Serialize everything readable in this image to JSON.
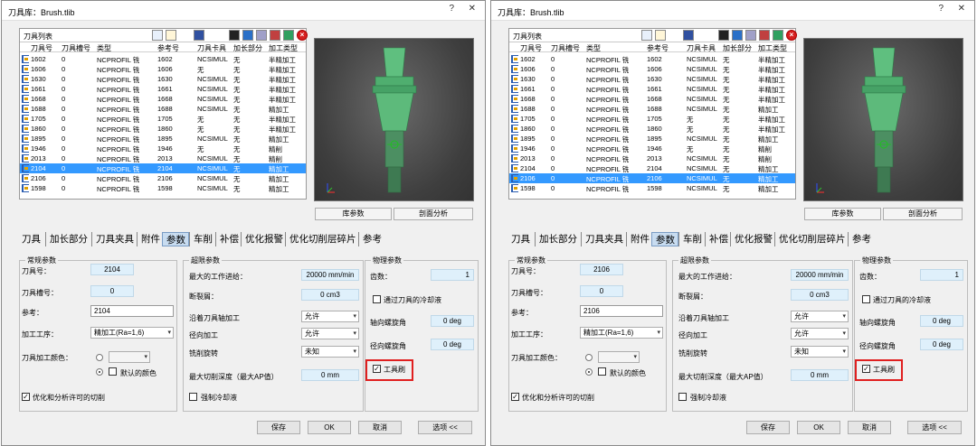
{
  "windows": [
    {
      "title": "刀具库：Brush.tlib",
      "help_glyph": "?",
      "close_glyph": "✕",
      "list_title": "刀具列表",
      "columns": [
        "刀具号",
        "刀具槽号",
        "类型",
        "参考号",
        "刀具卡具",
        "加长部分",
        "加工类型"
      ],
      "rows": [
        [
          "1602",
          "0",
          "NCPROFIL 铣",
          "1602",
          "NCSIMUL",
          "无",
          "半精加工"
        ],
        [
          "1606",
          "0",
          "NCPROFIL 铣",
          "1606",
          "无",
          "无",
          "半精加工"
        ],
        [
          "1630",
          "0",
          "NCPROFIL 铣",
          "1630",
          "NCSIMUL",
          "无",
          "半精加工"
        ],
        [
          "1661",
          "0",
          "NCPROFIL 铣",
          "1661",
          "NCSIMUL",
          "无",
          "半精加工"
        ],
        [
          "1668",
          "0",
          "NCPROFIL 铣",
          "1668",
          "NCSIMUL",
          "无",
          "半精加工"
        ],
        [
          "1688",
          "0",
          "NCPROFIL 铣",
          "1688",
          "NCSIMUL",
          "无",
          "精加工"
        ],
        [
          "1705",
          "0",
          "NCPROFIL 铣",
          "1705",
          "无",
          "无",
          "半精加工"
        ],
        [
          "1860",
          "0",
          "NCPROFIL 铣",
          "1860",
          "无",
          "无",
          "半精加工"
        ],
        [
          "1895",
          "0",
          "NCPROFIL 铣",
          "1895",
          "NCSIMUL",
          "无",
          "精加工"
        ],
        [
          "1946",
          "0",
          "NCPROFIL 铣",
          "1946",
          "无",
          "无",
          "精削"
        ],
        [
          "2013",
          "0",
          "NCPROFIL 铣",
          "2013",
          "NCSIMUL",
          "无",
          "精削"
        ],
        [
          "2104",
          "0",
          "NCPROFIL 铣",
          "2104",
          "NCSIMUL",
          "无",
          "精加工"
        ],
        [
          "2106",
          "0",
          "NCPROFIL 铣",
          "2106",
          "NCSIMUL",
          "无",
          "精加工"
        ],
        [
          "1598",
          "0",
          "NCPROFIL 铣",
          "1598",
          "NCSIMUL",
          "无",
          "精加工"
        ]
      ],
      "selected_row": 11,
      "view_buttons": [
        "库参数",
        "剖面分析"
      ],
      "tabs": [
        "刀具",
        "加长部分",
        "刀具夹具",
        "附件",
        "参数",
        "车削",
        "补偿",
        "优化报警",
        "优化切削层碎片",
        "参考"
      ],
      "active_tab": 4,
      "general": {
        "title": "常规参数",
        "tool_number_label": "刀具号：",
        "tool_number": "2104",
        "slot_label": "刀具槽号：",
        "slot": "0",
        "ref_label": "参考：",
        "ref": "2104",
        "process_label": "加工工序：",
        "process": "精加工(Ra=1,6)",
        "color_label": "刀具加工颜色：",
        "default_color": "默认的颜色",
        "optimize_label": "优化和分析许可的切削",
        "dropdown_glyph": "▾",
        "check_glyph": "✓"
      },
      "limits": {
        "title": "超限参数",
        "max_feed_label": "最大的工作进给：",
        "max_feed": "20000 mm/min",
        "chip_label": "断裂屑：",
        "chip": "0 cm3",
        "axial_label": "沿着刀具轴加工",
        "axial": "允许",
        "radial_label": "径向加工",
        "radial": "允许",
        "helix_label": "铣削旋转",
        "helix": "未知",
        "max_depth_label": "最大切削深度（最大AP值）",
        "max_depth": "0 mm",
        "coolant_label": "强制冷却液"
      },
      "physical": {
        "title": "物理参数",
        "teeth_label": "齿数：",
        "teeth": "1",
        "through_coolant_label": "通过刀具的冷却液",
        "axial_helix_label": "轴向螺旋角",
        "axial_helix": "0 deg",
        "radial_helix_label": "径向螺旋角",
        "radial_helix": "0 deg",
        "brush_label": "工具刷"
      },
      "buttons": {
        "save": "保存",
        "ok": "OK",
        "cancel": "取消",
        "options": "选项 <<"
      }
    },
    {
      "title": "刀具库：Brush.tlib",
      "help_glyph": "?",
      "close_glyph": "✕",
      "list_title": "刀具列表",
      "columns": [
        "刀具号",
        "刀具槽号",
        "类型",
        "参考号",
        "刀具卡具",
        "加长部分",
        "加工类型"
      ],
      "rows": [
        [
          "1602",
          "0",
          "NCPROFIL 铣",
          "1602",
          "NCSIMUL",
          "无",
          "半精加工"
        ],
        [
          "1606",
          "0",
          "NCPROFIL 铣",
          "1606",
          "NCSIMUL",
          "无",
          "半精加工"
        ],
        [
          "1630",
          "0",
          "NCPROFIL 铣",
          "1630",
          "NCSIMUL",
          "无",
          "半精加工"
        ],
        [
          "1661",
          "0",
          "NCPROFIL 铣",
          "1661",
          "NCSIMUL",
          "无",
          "半精加工"
        ],
        [
          "1668",
          "0",
          "NCPROFIL 铣",
          "1668",
          "NCSIMUL",
          "无",
          "半精加工"
        ],
        [
          "1688",
          "0",
          "NCPROFIL 铣",
          "1688",
          "NCSIMUL",
          "无",
          "精加工"
        ],
        [
          "1705",
          "0",
          "NCPROFIL 铣",
          "1705",
          "无",
          "无",
          "半精加工"
        ],
        [
          "1860",
          "0",
          "NCPROFIL 铣",
          "1860",
          "无",
          "无",
          "半精加工"
        ],
        [
          "1895",
          "0",
          "NCPROFIL 铣",
          "1895",
          "NCSIMUL",
          "无",
          "精加工"
        ],
        [
          "1946",
          "0",
          "NCPROFIL 铣",
          "1946",
          "无",
          "无",
          "精削"
        ],
        [
          "2013",
          "0",
          "NCPROFIL 铣",
          "2013",
          "NCSIMUL",
          "无",
          "精削"
        ],
        [
          "2104",
          "0",
          "NCPROFIL 铣",
          "2104",
          "NCSIMUL",
          "无",
          "精加工"
        ],
        [
          "2106",
          "0",
          "NCPROFIL 铣",
          "2106",
          "NCSIMUL",
          "无",
          "精加工"
        ],
        [
          "1598",
          "0",
          "NCPROFIL 铣",
          "1598",
          "NCSIMUL",
          "无",
          "精加工"
        ]
      ],
      "selected_row": 12,
      "view_buttons": [
        "库参数",
        "剖面分析"
      ],
      "tabs": [
        "刀具",
        "加长部分",
        "刀具夹具",
        "附件",
        "参数",
        "车削",
        "补偿",
        "优化报警",
        "优化切削层碎片",
        "参考"
      ],
      "active_tab": 4,
      "general": {
        "title": "常规参数",
        "tool_number_label": "刀具号：",
        "tool_number": "2106",
        "slot_label": "刀具槽号：",
        "slot": "0",
        "ref_label": "参考：",
        "ref": "2106",
        "process_label": "加工工序：",
        "process": "精加工(Ra=1,6)",
        "color_label": "刀具加工颜色：",
        "default_color": "默认的颜色",
        "optimize_label": "优化和分析许可的切削",
        "dropdown_glyph": "▾",
        "check_glyph": "✓"
      },
      "limits": {
        "title": "超限参数",
        "max_feed_label": "最大的工作进给：",
        "max_feed": "20000 mm/min",
        "chip_label": "断裂屑：",
        "chip": "0 cm3",
        "axial_label": "沿着刀具轴加工",
        "axial": "允许",
        "radial_label": "径向加工",
        "radial": "允许",
        "helix_label": "铣削旋转",
        "helix": "未知",
        "max_depth_label": "最大切削深度（最大AP值）",
        "max_depth": "0 mm",
        "coolant_label": "强制冷却液"
      },
      "physical": {
        "title": "物理参数",
        "teeth_label": "齿数：",
        "teeth": "1",
        "through_coolant_label": "通过刀具的冷却液",
        "axial_helix_label": "轴向螺旋角",
        "axial_helix": "0 deg",
        "radial_helix_label": "径向螺旋角",
        "radial_helix": "0 deg",
        "brush_label": "工具刷"
      },
      "buttons": {
        "save": "保存",
        "ok": "OK",
        "cancel": "取消",
        "options": "选项 <<"
      }
    }
  ]
}
